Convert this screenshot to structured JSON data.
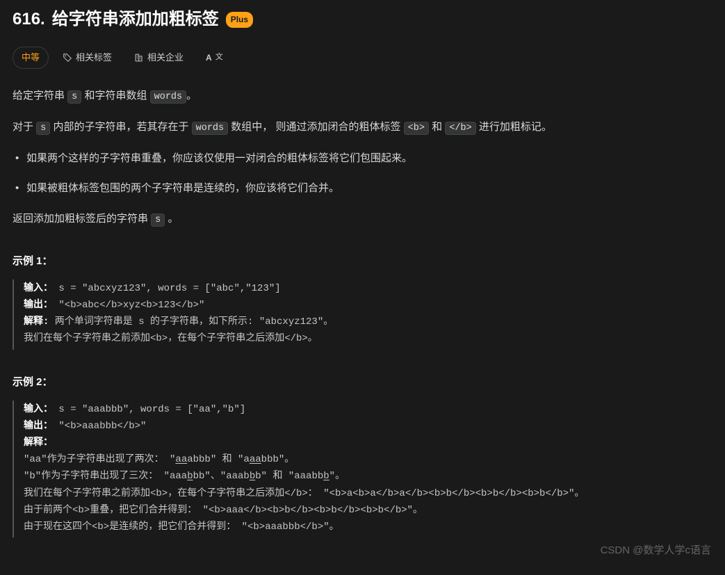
{
  "header": {
    "problem_number": "616.",
    "title": "给字符串添加加粗标签",
    "plus_badge": "Plus"
  },
  "meta": {
    "difficulty": "中等",
    "tags_label": "相关标签",
    "companies_label": "相关企业",
    "translate_label": "Aㅊ"
  },
  "desc": {
    "p1_a": "给定字符串 ",
    "p1_code1": "s",
    "p1_b": " 和字符串数组 ",
    "p1_code2": "words",
    "p1_c": "。",
    "p2_a": "对于 ",
    "p2_code1": "s",
    "p2_b": " 内部的子字符串，若其存在于 ",
    "p2_code2": "words",
    "p2_c": " 数组中， 则通过添加闭合的粗体标签 ",
    "p2_code3": "<b>",
    "p2_d": " 和 ",
    "p2_code4": "</b>",
    "p2_e": " 进行加粗标记。",
    "li1": "如果两个这样的子字符串重叠，你应该仅使用一对闭合的粗体标签将它们包围起来。",
    "li2": "如果被粗体标签包围的两个子字符串是连续的，你应该将它们合并。",
    "p3_a": "返回添加加粗标签后的字符串 ",
    "p3_code1": "s",
    "p3_b": " 。"
  },
  "ex1": {
    "title": "示例 1：",
    "input_label": "输入：",
    "input_val": "  s = \"abcxyz123\", words = [\"abc\",\"123\"]",
    "output_label": "输出：",
    "output_val": " \"<b>abc</b>xyz<b>123</b>\"",
    "explain_label": "解释:",
    "explain_a": " 两个单词字符串是 s 的子字符串，如下所示: \"abcxyz123\"。",
    "explain_b": "我们在每个子字符串之前添加<b>，在每个子字符串之后添加</b>。"
  },
  "ex2": {
    "title": "示例 2：",
    "input_label": "输入：",
    "input_val": " s = \"aaabbb\", words = [\"aa\",\"b\"]",
    "output_label": "输出：",
    "output_val": " \"<b>aaabbb</b>\"",
    "explain_label": "解释："
  },
  "watermark": "CSDN @数学人学c语言"
}
